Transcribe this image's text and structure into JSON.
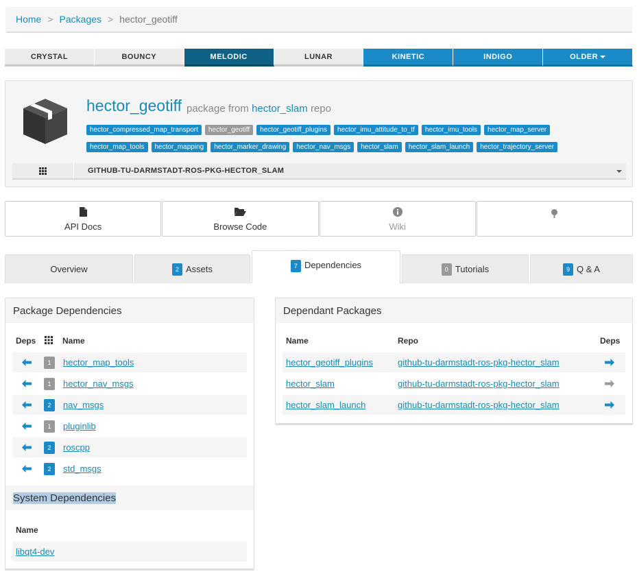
{
  "breadcrumb": {
    "home": "Home",
    "packages": "Packages",
    "current": "hector_geotiff"
  },
  "distros": [
    {
      "label": "CRYSTAL",
      "state": "old"
    },
    {
      "label": "BOUNCY",
      "state": "old"
    },
    {
      "label": "MELODIC",
      "state": "active"
    },
    {
      "label": "LUNAR",
      "state": "old"
    },
    {
      "label": "KINETIC",
      "state": "new"
    },
    {
      "label": "INDIGO",
      "state": "new"
    },
    {
      "label": "OLDER",
      "state": "new"
    }
  ],
  "package": {
    "name": "hector_geotiff",
    "from_text": "package from",
    "repo": "hector_slam",
    "repo_suffix": "repo",
    "tags_row1": [
      "hector_compressed_map_transport",
      "hector_geotiff",
      "hector_geotiff_plugins",
      "hector_imu_attitude_to_tf",
      "hector_imu_tools",
      "hector_map_server"
    ],
    "tags_row2": [
      "hector_map_tools",
      "hector_mapping",
      "hector_marker_drawing",
      "hector_nav_msgs",
      "hector_slam",
      "hector_slam_launch",
      "hector_trajectory_server"
    ],
    "current_tag": "hector_geotiff",
    "repo_select": "GITHUB-TU-DARMSTADT-ROS-PKG-HECTOR_SLAM"
  },
  "doc_buttons": [
    {
      "label": "API Docs",
      "icon": "file-icon"
    },
    {
      "label": "Browse Code",
      "icon": "folder-open-icon"
    },
    {
      "label": "Wiki",
      "icon": "info-circle-icon"
    },
    {
      "label": "",
      "icon": "tree-icon"
    }
  ],
  "tabs": [
    {
      "label": "Overview",
      "count": ""
    },
    {
      "label": "Assets",
      "count": "2"
    },
    {
      "label": "Dependencies",
      "count": "7"
    },
    {
      "label": "Tutorials",
      "count": "0"
    },
    {
      "label": "Q & A",
      "count": "9"
    }
  ],
  "package_deps": {
    "title": "Package Dependencies",
    "col_deps": "Deps",
    "col_name": "Name",
    "rows": [
      {
        "count": "1",
        "name": "hector_map_tools"
      },
      {
        "count": "1",
        "name": "hector_nav_msgs"
      },
      {
        "count": "2",
        "name": "nav_msgs"
      },
      {
        "count": "1",
        "name": "pluginlib"
      },
      {
        "count": "2",
        "name": "roscpp"
      },
      {
        "count": "2",
        "name": "std_msgs"
      }
    ]
  },
  "system_deps": {
    "title": "System Dependencies",
    "col_name": "Name",
    "rows": [
      "libqt4-dev"
    ]
  },
  "dependants": {
    "title": "Dependant Packages",
    "col_name": "Name",
    "col_repo": "Repo",
    "col_deps": "Deps",
    "rows": [
      {
        "name": "hector_geotiff_plugins",
        "repo": "github-tu-darmstadt-ros-pkg-hector_slam",
        "arrow": "blue"
      },
      {
        "name": "hector_slam",
        "repo": "github-tu-darmstadt-ros-pkg-hector_slam",
        "arrow": "grey"
      },
      {
        "name": "hector_slam_launch",
        "repo": "github-tu-darmstadt-ros-pkg-hector_slam",
        "arrow": "blue"
      }
    ]
  },
  "colors": {
    "accent": "#1a8bc6",
    "active_distro": "#0f6285",
    "link": "#1a8bb3"
  }
}
